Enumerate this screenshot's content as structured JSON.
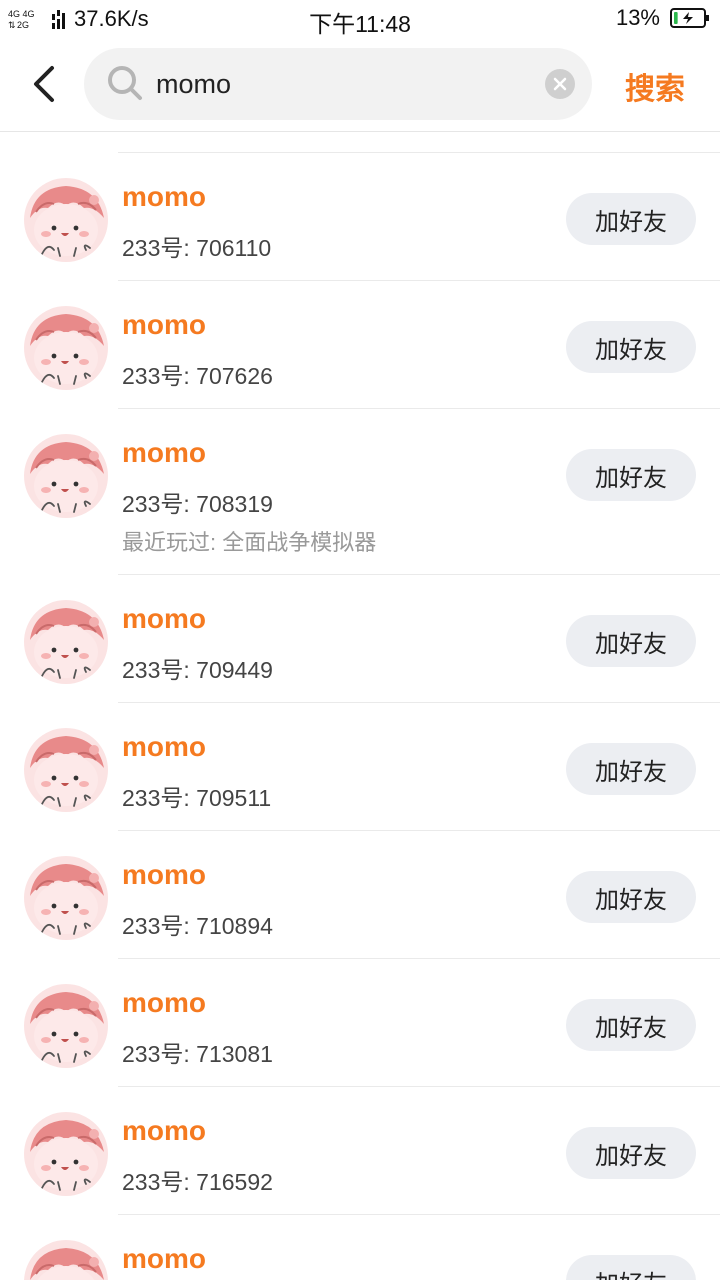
{
  "status_bar": {
    "network_label_top": "4G 4G",
    "network_label_bottom": "2G",
    "speed": "37.6K/s",
    "time": "下午11:48",
    "battery_percent": "13%",
    "battery_level": 0.13,
    "battery_color": "#2db84d"
  },
  "header": {
    "search_value": "momo",
    "search_button": "搜索",
    "accent_color": "#f57a20"
  },
  "results": [
    {
      "name": "momo",
      "id_text": "233号: 706110",
      "add_label": "加好友"
    },
    {
      "name": "momo",
      "id_text": "233号: 707626",
      "add_label": "加好友"
    },
    {
      "name": "momo",
      "id_text": "233号: 708319",
      "played_text": "最近玩过: 全面战争模拟器",
      "add_label": "加好友"
    },
    {
      "name": "momo",
      "id_text": "233号: 709449",
      "add_label": "加好友"
    },
    {
      "name": "momo",
      "id_text": "233号: 709511",
      "add_label": "加好友"
    },
    {
      "name": "momo",
      "id_text": "233号: 710894",
      "add_label": "加好友"
    },
    {
      "name": "momo",
      "id_text": "233号: 713081",
      "add_label": "加好友"
    },
    {
      "name": "momo",
      "id_text": "233号: 716592",
      "add_label": "加好友"
    },
    {
      "name": "momo",
      "id_text": "",
      "add_label": "加好友"
    }
  ],
  "icons": {
    "back": "back-arrow-icon",
    "search": "search-icon",
    "clear": "clear-icon",
    "avatar": "momo-avatar-icon"
  }
}
